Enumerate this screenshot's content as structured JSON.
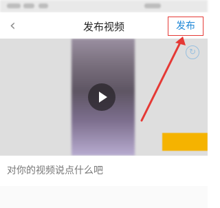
{
  "navbar": {
    "back_icon": "chevron-left-icon",
    "title": "发布视频",
    "publish_label": "发布"
  },
  "media": {
    "play_icon": "play-icon",
    "rotate_icon": "rotate-icon",
    "cover_label": ""
  },
  "caption": {
    "placeholder": "对你的视频说点什么吧"
  },
  "colors": {
    "accent_blue": "#1e86d6",
    "highlight_red": "#e53935",
    "cover_yellow": "#f5b300"
  }
}
